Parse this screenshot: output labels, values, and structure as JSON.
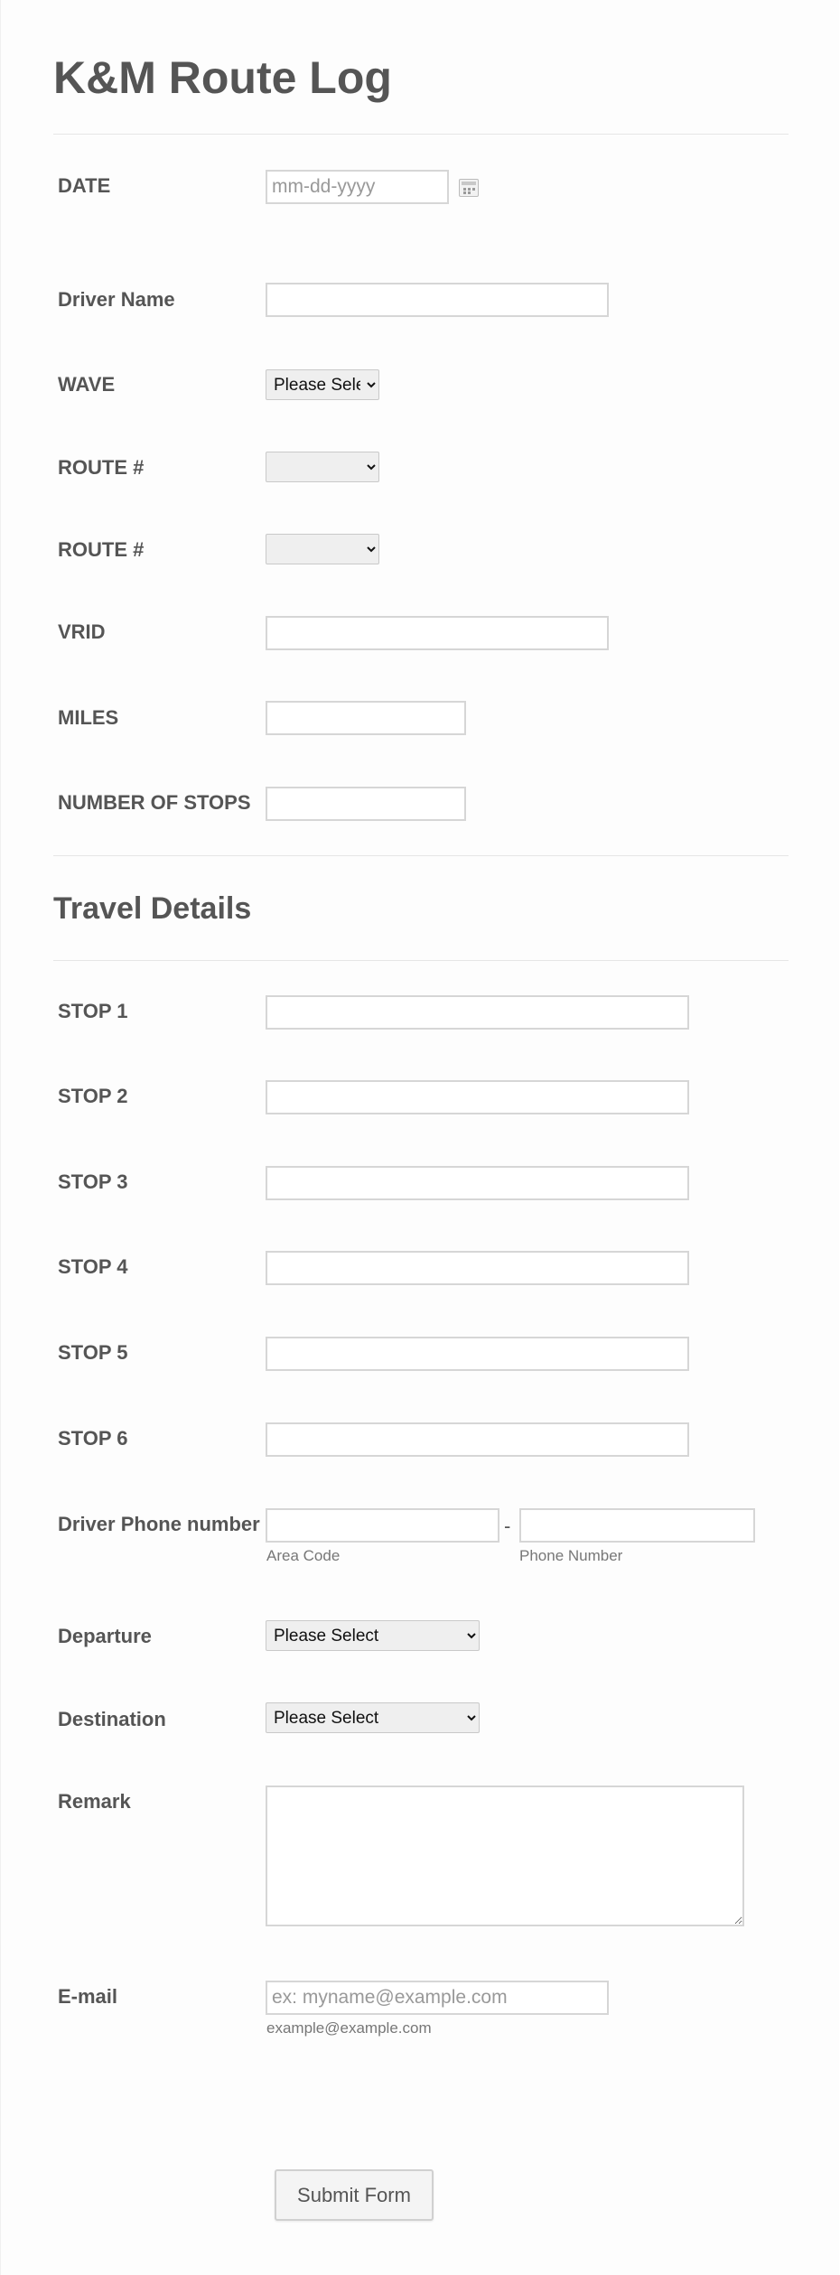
{
  "form": {
    "title": "K&M Route Log",
    "section_title": "Travel Details",
    "submit_label": "Submit Form"
  },
  "fields": {
    "date": {
      "label": "DATE",
      "placeholder": "mm-dd-yyyy",
      "value": ""
    },
    "driver_name": {
      "label": "Driver Name",
      "value": ""
    },
    "wave": {
      "label": "WAVE",
      "selected": "Please Select"
    },
    "route_1": {
      "label": "ROUTE #",
      "selected": ""
    },
    "route_2": {
      "label": "ROUTE #",
      "selected": ""
    },
    "vrid": {
      "label": "VRID",
      "value": ""
    },
    "miles": {
      "label": "MILES",
      "value": ""
    },
    "number_of_stops": {
      "label": "NUMBER OF STOPS",
      "value": ""
    },
    "stops": [
      {
        "label": "STOP 1",
        "value": ""
      },
      {
        "label": "STOP 2",
        "value": ""
      },
      {
        "label": "STOP 3",
        "value": ""
      },
      {
        "label": "STOP 4",
        "value": ""
      },
      {
        "label": "STOP 5",
        "value": ""
      },
      {
        "label": "STOP 6",
        "value": ""
      }
    ],
    "phone": {
      "label": "Driver Phone number",
      "separator": "-",
      "area_code_sublabel": "Area Code",
      "number_sublabel": "Phone Number"
    },
    "departure": {
      "label": "Departure",
      "selected": "Please Select"
    },
    "destination": {
      "label": "Destination",
      "selected": "Please Select"
    },
    "remark": {
      "label": "Remark",
      "value": ""
    },
    "email": {
      "label": "E-mail",
      "placeholder": "ex: myname@example.com",
      "sublabel": "example@example.com"
    }
  },
  "icons": {
    "calendar": "calendar-icon",
    "dropdown": "chevron-down-icon"
  }
}
